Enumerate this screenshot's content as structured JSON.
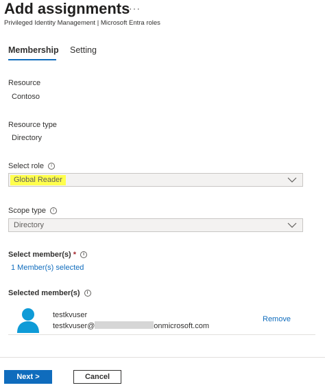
{
  "header": {
    "title": "Add assignments",
    "more_icon": "ellipsis-icon",
    "more_label": "···",
    "subtitle": "Privileged Identity Management | Microsoft Entra roles"
  },
  "tabs": [
    {
      "label": "Membership",
      "selected": true
    },
    {
      "label": "Setting",
      "selected": false
    }
  ],
  "resource": {
    "label": "Resource",
    "value": "Contoso"
  },
  "resource_type": {
    "label": "Resource type",
    "value": "Directory"
  },
  "select_role": {
    "label": "Select role",
    "value": "Global Reader",
    "highlight_color": "#ffff4d",
    "info_icon": "info-icon"
  },
  "scope_type": {
    "label": "Scope type",
    "value": "Directory",
    "info_icon": "info-icon"
  },
  "select_members": {
    "label": "Select member(s)",
    "required_mark": "*",
    "link": "1 Member(s) selected",
    "info_icon": "info-icon"
  },
  "selected_members": {
    "label": "Selected member(s)",
    "items": [
      {
        "name": "testkvuser",
        "email_prefix": "testkvuser@",
        "email_suffix": "onmicrosoft.com",
        "avatar_icon": "user-avatar-icon",
        "action": "Remove"
      }
    ]
  },
  "footer": {
    "next_label": "Next >",
    "cancel_label": "Cancel"
  },
  "colors": {
    "accent": "#0f6cbd",
    "required": "#a4262c",
    "avatar": "#0f9bd7"
  }
}
